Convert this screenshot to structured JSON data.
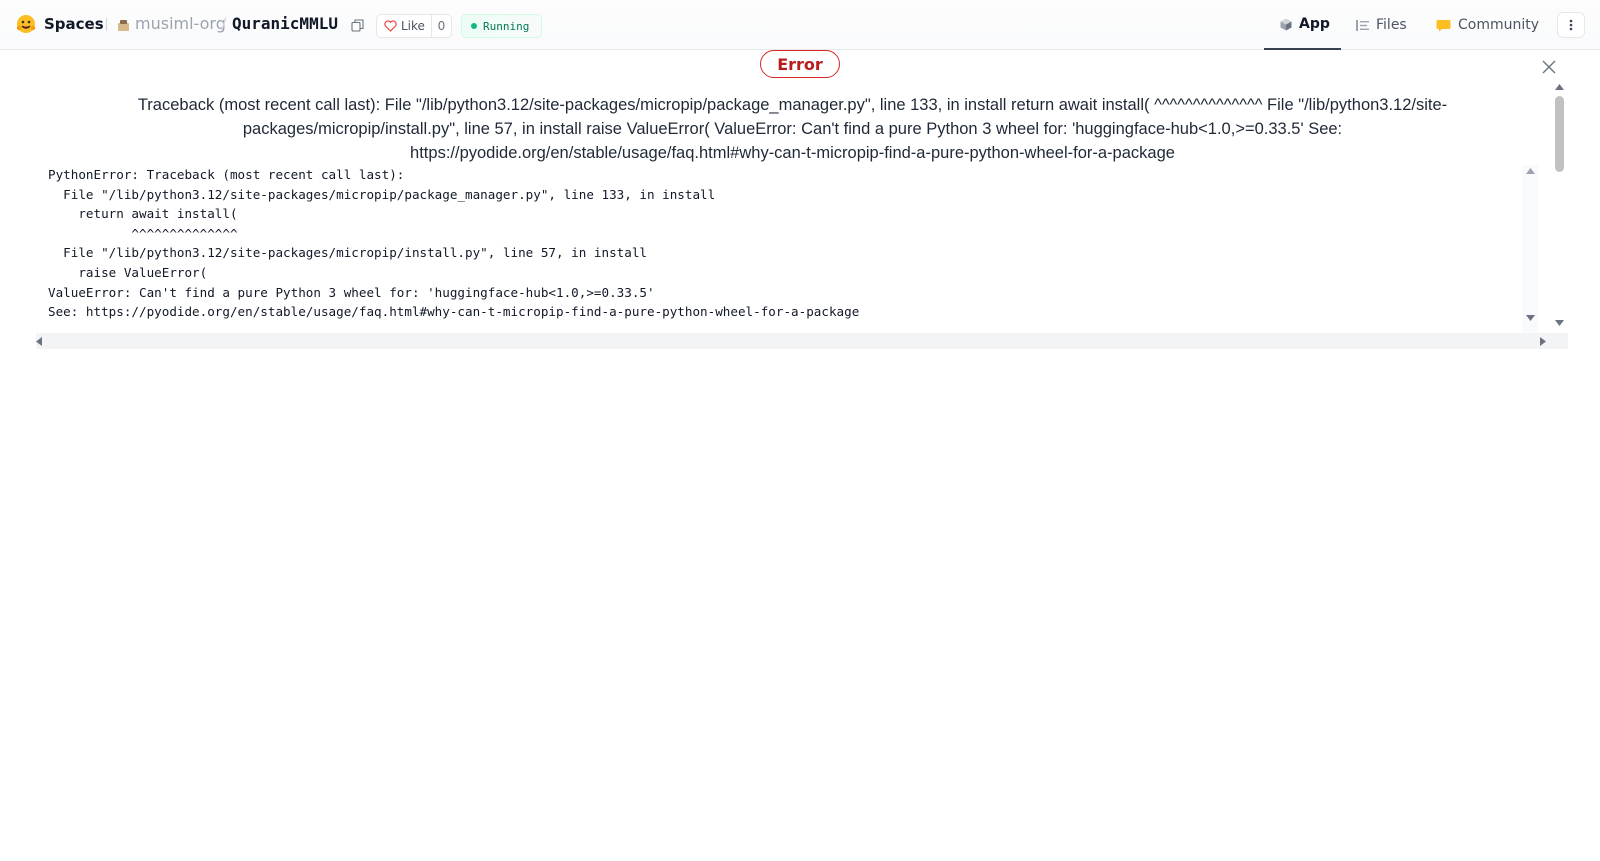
{
  "header": {
    "brand": "Spaces",
    "org": "musiml-org",
    "separator": "/",
    "repo": "QuranicMMLU",
    "like_label": "Like",
    "like_count": "0",
    "status": "Running",
    "tabs": [
      {
        "label": "App",
        "icon": "cube-icon",
        "active": true
      },
      {
        "label": "Files",
        "icon": "files-icon",
        "active": false
      },
      {
        "label": "Community",
        "icon": "community-icon",
        "active": false
      }
    ]
  },
  "error": {
    "badge": "Error",
    "summary": "Traceback (most recent call last): File \"/lib/python3.12/site-packages/micropip/package_manager.py\", line 133, in install return await install( ^^^^^^^^^^^^^^ File \"/lib/python3.12/site-packages/micropip/install.py\", line 57, in install raise ValueError( ValueError: Can't find a pure Python 3 wheel for: 'huggingface-hub<1.0,>=0.33.5' See: https://pyodide.org/en/stable/usage/faq.html#why-can-t-micropip-find-a-pure-python-wheel-for-a-package",
    "traceback": "PythonError: Traceback (most recent call last):\n  File \"/lib/python3.12/site-packages/micropip/package_manager.py\", line 133, in install\n    return await install(\n           ^^^^^^^^^^^^^^\n  File \"/lib/python3.12/site-packages/micropip/install.py\", line 57, in install\n    raise ValueError(\nValueError: Can't find a pure Python 3 wheel for: 'huggingface-hub<1.0,>=0.33.5'\nSee: https://pyodide.org/en/stable/usage/faq.html#why-can-t-micropip-find-a-pure-python-wheel-for-a-package"
  },
  "colors": {
    "error": "#dc2626",
    "running": "#10b981",
    "accent_yellow": "#fbbf24"
  }
}
